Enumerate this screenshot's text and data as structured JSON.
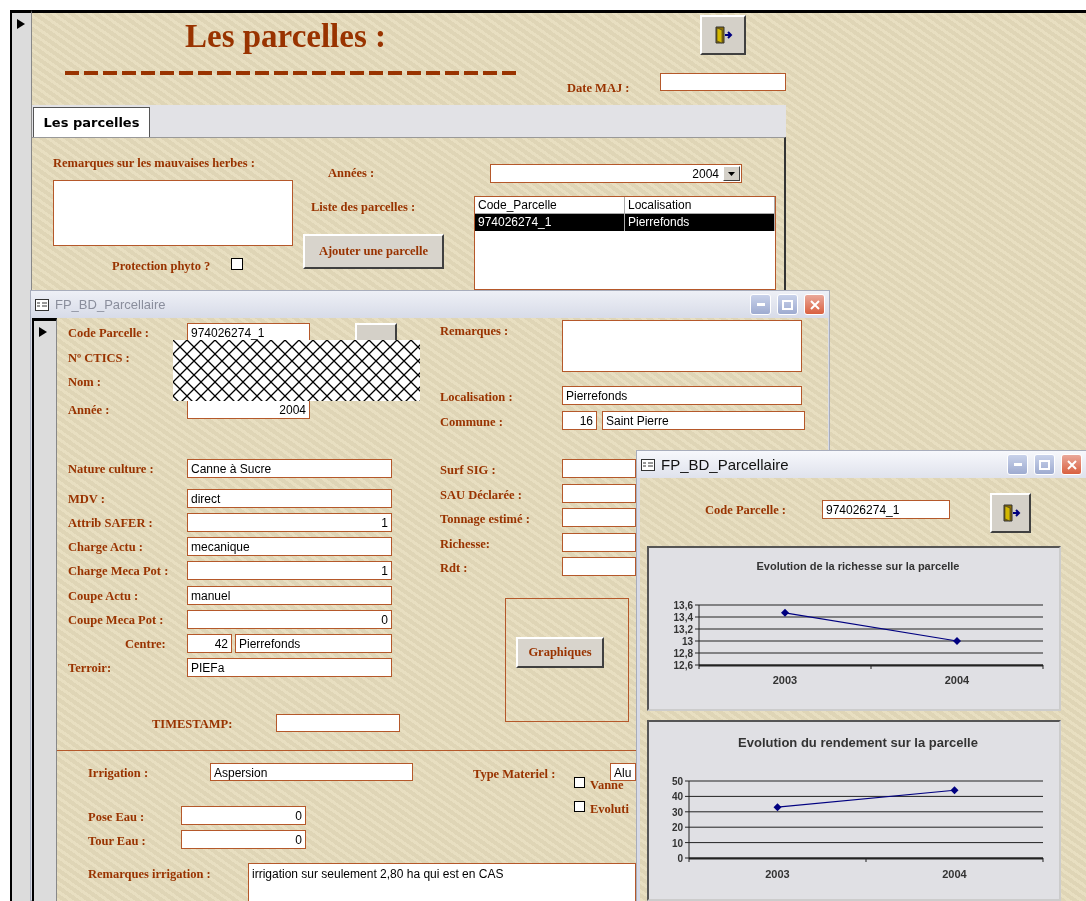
{
  "main_form": {
    "title": "Les parcelles :",
    "date_label": "Date MAJ :",
    "tabs": [
      {
        "label": "Les parcelles",
        "selected": true
      }
    ],
    "page": {
      "weeds_label": "Remarques sur les mauvaises herbes :",
      "years_label": "Années :",
      "year_value": "2004",
      "list_label": "Liste des parcelles :",
      "list_columns": [
        "Code_Parcelle",
        "Localisation"
      ],
      "list_rows": [
        {
          "cells": [
            "974026274_1",
            "Pierrefonds"
          ],
          "selected": true
        }
      ],
      "add_button": "Ajouter une parcelle",
      "phyto": {
        "label": "Protection phyto ?",
        "checked": false
      }
    }
  },
  "detail_window": {
    "title": "FP_BD_Parcellaire",
    "active": false,
    "left_fields": [
      {
        "label": "Code Parcelle :",
        "kind": "text",
        "value": "974026274_1"
      },
      {
        "label": "Nº CTICS :",
        "kind": "hidden"
      },
      {
        "label": "Nom :",
        "kind": "hidden"
      },
      {
        "label": "Année :",
        "kind": "number",
        "value": "2004"
      },
      {
        "label": "Nature culture :",
        "kind": "text",
        "value": "Canne à Sucre"
      },
      {
        "label": "MDV :",
        "kind": "text",
        "value": "direct"
      },
      {
        "label": "Attrib SAFER :",
        "kind": "number",
        "value": "1"
      },
      {
        "label": "Charge Actu :",
        "kind": "text",
        "value": "mecanique"
      },
      {
        "label": "Charge Meca Pot :",
        "kind": "number",
        "value": "1"
      },
      {
        "label": "Coupe Actu :",
        "kind": "text",
        "value": "manuel"
      },
      {
        "label": "Coupe Meca Pot :",
        "kind": "number",
        "value": "0"
      },
      {
        "label": "Centre:",
        "kind": "pair",
        "value": "42",
        "value_2": "Pierrefonds"
      },
      {
        "label": "Terroir:",
        "kind": "text",
        "value": "PIEFa"
      }
    ],
    "right_fields": [
      {
        "label": "Remarques :",
        "kind": "memo"
      },
      {
        "label": "Localisation :",
        "kind": "text",
        "value": "Pierrefonds"
      },
      {
        "label": "Commune :",
        "kind": "pair",
        "value": "16",
        "value_2": "Saint Pierre"
      },
      {
        "label": "Surf SIG :",
        "kind": "text"
      },
      {
        "label": "SAU Déclarée :",
        "kind": "text"
      },
      {
        "label": "Tonnage estimé :",
        "kind": "text"
      },
      {
        "label": "Richesse:",
        "kind": "text"
      },
      {
        "label": "Rdt :",
        "kind": "text"
      }
    ],
    "timestamp_label": "TIMESTAMP:",
    "graph_button": "Graphiques",
    "irrigation": {
      "label": "Irrigation :",
      "value": "Aspersion",
      "material_label": "Type Materiel :",
      "material_value": "Alu",
      "checks": [
        {
          "label": "Vanne",
          "checked": false
        },
        {
          "label": "Evoluti",
          "checked": false
        }
      ],
      "pose_label": "Pose Eau :",
      "pose_value": "0",
      "tour_label": "Tour Eau :",
      "tour_value": "0",
      "remarks_label": "Remarques irrigation :",
      "remarks_value": "irrigation sur seulement 2,80 ha qui est en CAS"
    }
  },
  "chart_window": {
    "title": "FP_BD_Parcellaire",
    "active": true,
    "code_label": "Code Parcelle :",
    "code_value": "974026274_1",
    "charts": [
      {
        "chart_data": {
          "type": "line",
          "title": "Evolution de la richesse sur la parcelle",
          "categories": [
            "2003",
            "2004"
          ],
          "grid": true,
          "series": [
            {
              "color": "#000080",
              "marker": "diamond",
              "values": [
                13.47,
                13.0
              ]
            }
          ],
          "ylim": [
            12.6,
            13.6
          ],
          "yticks": [
            {
              "value": 12.6,
              "label": "12,6"
            },
            {
              "value": 12.8,
              "label": "12,8"
            },
            {
              "value": 13,
              "label": "13"
            },
            {
              "value": 13.2,
              "label": "13,2"
            },
            {
              "value": 13.4,
              "label": "13,4"
            },
            {
              "value": 13.6,
              "label": "13,6"
            }
          ]
        }
      },
      {
        "chart_data": {
          "type": "line",
          "title": "Evolution du rendement sur la parcelle",
          "categories": [
            "2003",
            "2004"
          ],
          "grid": true,
          "series": [
            {
              "color": "#000080",
              "marker": "diamond",
              "values": [
                33,
                44
              ]
            }
          ],
          "ylim": [
            0,
            50
          ],
          "yticks": [
            0,
            10,
            20,
            30,
            40,
            50
          ]
        }
      }
    ]
  }
}
